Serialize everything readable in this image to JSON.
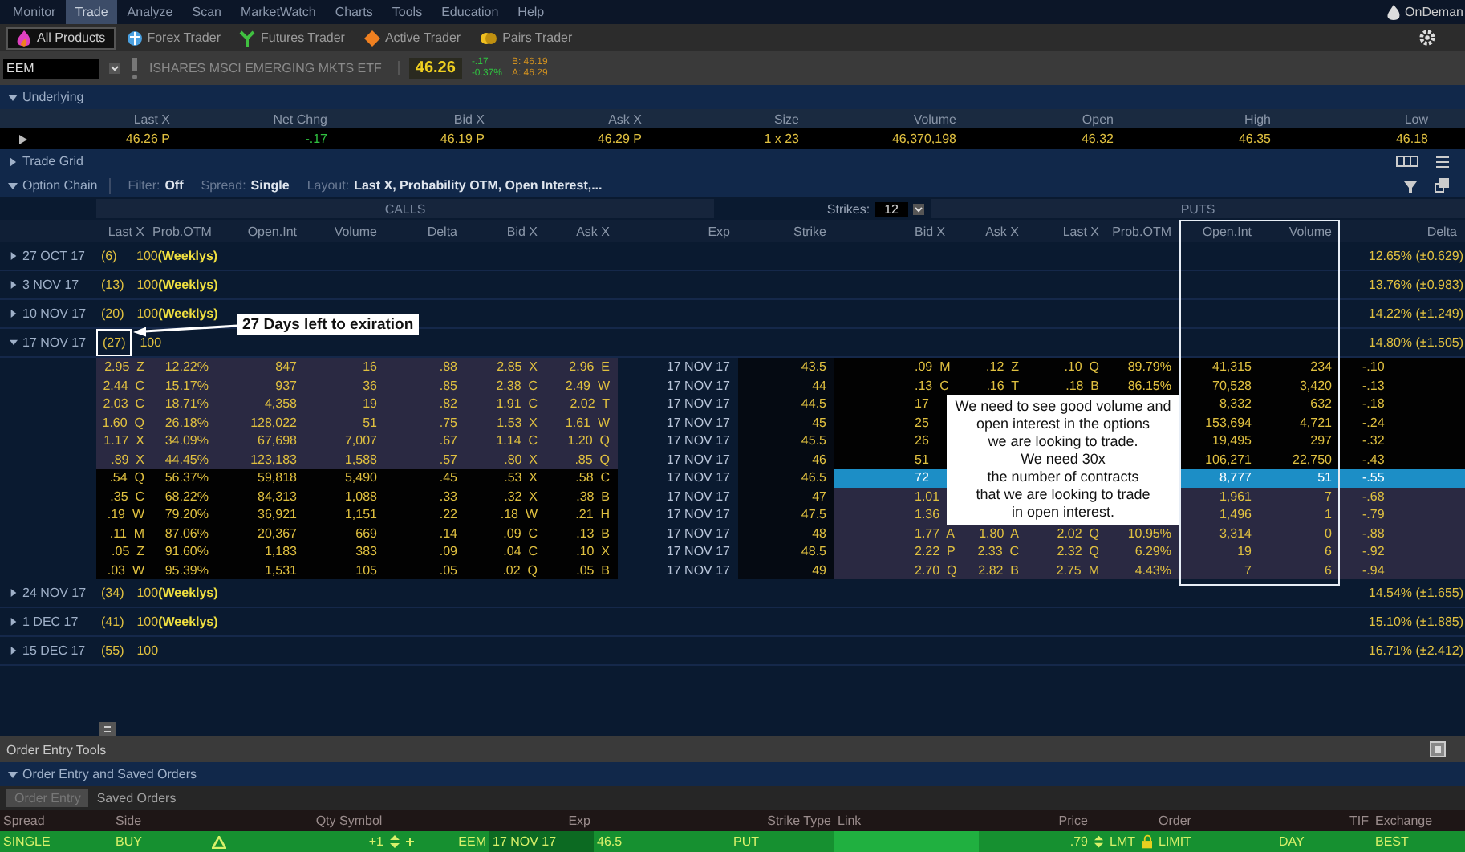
{
  "menu": [
    {
      "label": "Monitor",
      "selected": false
    },
    {
      "label": "Trade",
      "selected": true
    },
    {
      "label": "Analyze",
      "selected": false
    },
    {
      "label": "Scan",
      "selected": false
    },
    {
      "label": "MarketWatch",
      "selected": false
    },
    {
      "label": "Charts",
      "selected": false
    },
    {
      "label": "Tools",
      "selected": false
    },
    {
      "label": "Education",
      "selected": false
    },
    {
      "label": "Help",
      "selected": false
    }
  ],
  "ondemand": "OnDeman",
  "products": [
    {
      "label": "All Products",
      "kind": "all",
      "selected": true
    },
    {
      "label": "Forex Trader",
      "kind": "forex",
      "selected": false
    },
    {
      "label": "Futures Trader",
      "kind": "futures",
      "selected": false
    },
    {
      "label": "Active Trader",
      "kind": "active",
      "selected": false
    },
    {
      "label": "Pairs Trader",
      "kind": "pairs",
      "selected": false
    }
  ],
  "symbol": {
    "value": "EEM",
    "description": "ISHARES MSCI EMERGING MKTS ETF",
    "last": "46.26",
    "change": "-.17",
    "change_pct": "-0.37%",
    "bid": "B: 46.19",
    "ask": "A: 46.29"
  },
  "underlying": {
    "title": "Underlying",
    "expanded": true,
    "columns": [
      "Last X",
      "Net Chng",
      "Bid X",
      "Ask X",
      "Size",
      "Volume",
      "Open",
      "High",
      "Low"
    ],
    "values": [
      "46.26  P",
      "-.17",
      "46.19  P",
      "46.29  P",
      "1 x 23",
      "46,370,198",
      "46.32",
      "46.35",
      "46.18"
    ]
  },
  "trade_grid": {
    "title": "Trade Grid",
    "expanded": false
  },
  "option_chain": {
    "title": "Option Chain",
    "expanded": true,
    "filter_label": "Filter:",
    "filter": "Off",
    "spread_label": "Spread:",
    "spread": "Single",
    "layout_label": "Layout:",
    "layout": "Last X, Probability OTM, Open Interest,...",
    "calls_label": "CALLS",
    "puts_label": "PUTS",
    "strikes_label": "Strikes:",
    "strikes": "12",
    "columns": [
      "Last X",
      "Prob.OTM",
      "Open.Int",
      "Volume",
      "Delta",
      "Bid X",
      "Ask X",
      "Exp",
      "Strike",
      "Bid X",
      "Ask X",
      "Last X",
      "Prob.OTM",
      "Open.Int",
      "Volume",
      "Delta"
    ],
    "expirations": [
      {
        "date": "27 OCT 17",
        "days": "(6)",
        "multiplier": "100",
        "tag": "(Weeklys)",
        "expanded": false,
        "highlighted": false,
        "iv": "12.65% (±0.629)"
      },
      {
        "date": "3 NOV 17",
        "days": "(13)",
        "multiplier": "100",
        "tag": "(Weeklys)",
        "expanded": false,
        "highlighted": false,
        "iv": "13.76% (±0.983)"
      },
      {
        "date": "10 NOV 17",
        "days": "(20)",
        "multiplier": "100",
        "tag": "(Weeklys)",
        "expanded": false,
        "highlighted": false,
        "iv": "14.22% (±1.249)"
      },
      {
        "date": "17 NOV 17",
        "days": "(27)",
        "multiplier": "100",
        "expanded": true,
        "highlighted": true,
        "iv": "14.80% (±1.505)",
        "rows": [
          {
            "call": {
              "last": "2.95  Z",
              "prob_otm": "12.22%",
              "open_int": "847",
              "volume": "16",
              "delta": ".88",
              "bid": "2.85  X",
              "ask": "2.96  E",
              "itm": true
            },
            "exp": "17 NOV 17",
            "strike": "43.5",
            "put": {
              "bid": ".09  M",
              "ask": ".12  Z",
              "last": ".10  Q",
              "prob_otm": "89.79%",
              "open_int": "41,315",
              "volume": "234",
              "delta": "-.10",
              "itm": false,
              "selected": false
            }
          },
          {
            "call": {
              "last": "2.44  C",
              "prob_otm": "15.17%",
              "open_int": "937",
              "volume": "36",
              "delta": ".85",
              "bid": "2.38  C",
              "ask": "2.49  W",
              "itm": true
            },
            "exp": "17 NOV 17",
            "strike": "44",
            "put": {
              "bid": ".13  C",
              "ask": ".16  T",
              "last": ".18  B",
              "prob_otm": "86.15%",
              "open_int": "70,528",
              "volume": "3,420",
              "delta": "-.13",
              "itm": false,
              "selected": false
            }
          },
          {
            "call": {
              "last": "2.03  C",
              "prob_otm": "18.71%",
              "open_int": "4,358",
              "volume": "19",
              "delta": ".82",
              "bid": "1.91  C",
              "ask": "2.02  T",
              "itm": true
            },
            "exp": "17 NOV 17",
            "strike": "44.5",
            "put": {
              "bid": "17",
              "open_int": "8,332",
              "volume": "632",
              "delta": "-.18",
              "itm": false,
              "selected": false
            }
          },
          {
            "call": {
              "last": "1.60  Q",
              "prob_otm": "26.18%",
              "open_int": "128,022",
              "volume": "51",
              "delta": ".75",
              "bid": "1.53  X",
              "ask": "1.61  W",
              "itm": true
            },
            "exp": "17 NOV 17",
            "strike": "45",
            "put": {
              "bid": "25",
              "open_int": "153,694",
              "volume": "4,721",
              "delta": "-.24",
              "itm": false,
              "selected": false
            }
          },
          {
            "call": {
              "last": "1.17  X",
              "prob_otm": "34.09%",
              "open_int": "67,698",
              "volume": "7,007",
              "delta": ".67",
              "bid": "1.14  C",
              "ask": "1.20  Q",
              "itm": true
            },
            "exp": "17 NOV 17",
            "strike": "45.5",
            "put": {
              "bid": "26",
              "open_int": "19,495",
              "volume": "297",
              "delta": "-.32",
              "itm": false,
              "selected": false
            }
          },
          {
            "call": {
              "last": ".89  X",
              "prob_otm": "44.45%",
              "open_int": "123,183",
              "volume": "1,588",
              "delta": ".57",
              "bid": ".80  X",
              "ask": ".85  Q",
              "itm": true
            },
            "exp": "17 NOV 17",
            "strike": "46",
            "put": {
              "bid": "51",
              "open_int": "106,271",
              "volume": "22,750",
              "delta": "-.43",
              "itm": false,
              "selected": false
            }
          },
          {
            "call": {
              "last": ".54  Q",
              "prob_otm": "56.37%",
              "open_int": "59,818",
              "volume": "5,490",
              "delta": ".45",
              "bid": ".53  X",
              "ask": ".58  C",
              "itm": false
            },
            "exp": "17 NOV 17",
            "strike": "46.5",
            "put": {
              "bid": "72",
              "open_int": "8,777",
              "volume": "51",
              "delta": "-.55",
              "itm": true,
              "selected": true
            }
          },
          {
            "call": {
              "last": ".35  C",
              "prob_otm": "68.22%",
              "open_int": "84,313",
              "volume": "1,088",
              "delta": ".33",
              "bid": ".32  X",
              "ask": ".38  B",
              "itm": false
            },
            "exp": "17 NOV 17",
            "strike": "47",
            "put": {
              "bid": "1.01",
              "open_int": "1,961",
              "volume": "7",
              "delta": "-.68",
              "itm": true,
              "selected": false
            }
          },
          {
            "call": {
              "last": ".19  W",
              "prob_otm": "79.20%",
              "open_int": "36,921",
              "volume": "1,151",
              "delta": ".22",
              "bid": ".18  W",
              "ask": ".21  H",
              "itm": false
            },
            "exp": "17 NOV 17",
            "strike": "47.5",
            "put": {
              "bid": "1.36",
              "open_int": "1,496",
              "volume": "1",
              "delta": "-.79",
              "itm": true,
              "selected": false
            }
          },
          {
            "call": {
              "last": ".11  M",
              "prob_otm": "87.06%",
              "open_int": "20,367",
              "volume": "669",
              "delta": ".14",
              "bid": ".09  C",
              "ask": ".13  B",
              "itm": false
            },
            "exp": "17 NOV 17",
            "strike": "48",
            "put": {
              "bid": "1.77  A",
              "ask": "1.80  A",
              "last": "2.02  Q",
              "prob_otm": "10.95%",
              "open_int": "3,314",
              "volume": "0",
              "delta": "-.88",
              "itm": true,
              "selected": false
            }
          },
          {
            "call": {
              "last": ".05  Z",
              "prob_otm": "91.60%",
              "open_int": "1,183",
              "volume": "383",
              "delta": ".09",
              "bid": ".04  C",
              "ask": ".10  X",
              "itm": false
            },
            "exp": "17 NOV 17",
            "strike": "48.5",
            "put": {
              "bid": "2.22  P",
              "ask": "2.33  C",
              "last": "2.32  Q",
              "prob_otm": "6.29%",
              "open_int": "19",
              "volume": "6",
              "delta": "-.92",
              "itm": true,
              "selected": false
            }
          },
          {
            "call": {
              "last": ".03  W",
              "prob_otm": "95.39%",
              "open_int": "1,531",
              "volume": "105",
              "delta": ".05",
              "bid": ".02  Q",
              "ask": ".05  B",
              "itm": false
            },
            "exp": "17 NOV 17",
            "strike": "49",
            "put": {
              "bid": "2.70  Q",
              "ask": "2.82  B",
              "last": "2.75  M",
              "prob_otm": "4.43%",
              "open_int": "7",
              "volume": "6",
              "delta": "-.94",
              "itm": true,
              "selected": false
            }
          }
        ]
      },
      {
        "date": "24 NOV 17",
        "days": "(34)",
        "multiplier": "100",
        "tag": "(Weeklys)",
        "expanded": false,
        "highlighted": false,
        "iv": "14.54% (±1.655)"
      },
      {
        "date": "1 DEC 17",
        "days": "(41)",
        "multiplier": "100",
        "tag": "(Weeklys)",
        "expanded": false,
        "highlighted": false,
        "iv": "15.10% (±1.885)"
      },
      {
        "date": "15 DEC 17",
        "days": "(55)",
        "multiplier": "100",
        "expanded": false,
        "highlighted": false,
        "iv": "16.71% (±2.412)"
      }
    ]
  },
  "annotations": {
    "expiry_note": "27 Days left to exiration",
    "volume_note": "We need to see good volume and\nopen interest in the options\nwe are looking to trade.\nWe need 30x\nthe number of contracts\nthat we are looking to trade\nin open interest."
  },
  "order_tools": {
    "title": "Order Entry Tools"
  },
  "order_section": {
    "title": "Order Entry and Saved Orders",
    "expanded": true
  },
  "order_tabs": [
    {
      "label": "Order Entry",
      "selected": true
    },
    {
      "label": "Saved Orders",
      "selected": false
    }
  ],
  "order": {
    "columns": [
      "Spread",
      "Side",
      "Qty Symbol",
      "Exp",
      "Strike Type",
      "Link",
      "Price",
      "Order",
      "TIF",
      "Exchange"
    ],
    "row": {
      "spread": "SINGLE",
      "side": "BUY",
      "qty": "+1",
      "symbol": "EEM",
      "exp": "17 NOV 17",
      "strike": "46.5",
      "type": "PUT",
      "price": ".79",
      "price_type": "LMT",
      "order": "LIMIT",
      "tif": "DAY",
      "exchange": "BEST"
    }
  }
}
